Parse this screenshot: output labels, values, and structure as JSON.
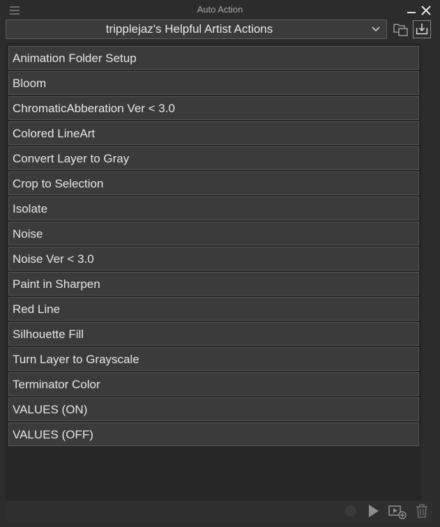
{
  "window": {
    "title": "Auto Action"
  },
  "set_selector": {
    "value": "tripplejaz's Helpful Artist Actions"
  },
  "actions": [
    "Animation Folder Setup",
    "Bloom",
    "ChromaticAbberation Ver < 3.0",
    "Colored LineArt",
    "Convert Layer to Gray",
    "Crop to Selection",
    "Isolate",
    "Noise",
    "Noise Ver < 3.0",
    "Paint in Sharpen",
    "Red Line",
    "Silhouette Fill",
    "Turn Layer to Grayscale",
    "Terminator Color",
    "VALUES (ON)",
    "VALUES (OFF)"
  ],
  "icons": {
    "menu": "menu-icon",
    "minimize": "minimize-icon",
    "close": "close-icon",
    "dropdown": "chevron-down-icon",
    "open_set": "folder-copy-icon",
    "import_set": "download-icon",
    "record": "record-icon",
    "play": "play-icon",
    "add_action": "add-action-icon",
    "delete": "trash-icon"
  },
  "colors": {
    "background": "#2c2c2c",
    "list_background": "#262626",
    "item_background": "#3b3b3b",
    "text": "#e6e6e6"
  }
}
